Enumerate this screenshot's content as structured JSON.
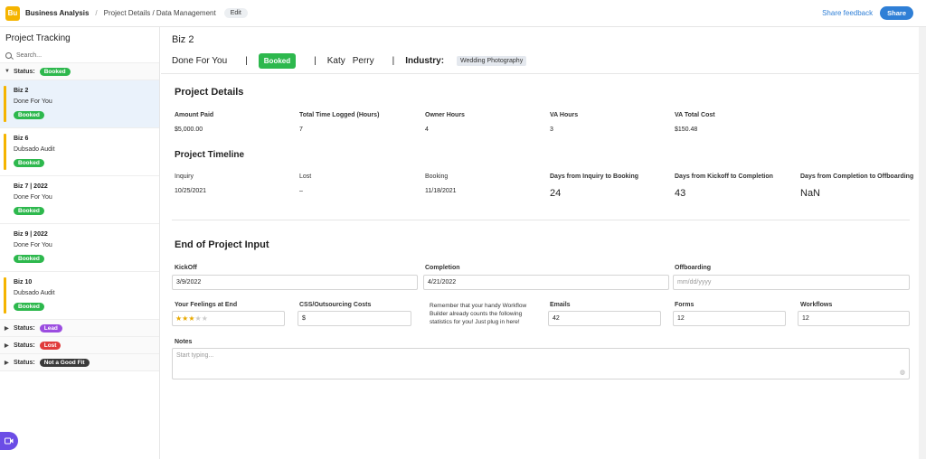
{
  "topbar": {
    "logo_text": "Bu",
    "app_title": "Business Analysis",
    "separator": "/",
    "breadcrumb": "Project Details / Data Management",
    "edit_label": "Edit",
    "share_feedback": "Share feedback",
    "share_label": "Share"
  },
  "sidebar": {
    "title": "Project Tracking",
    "search_placeholder": "Search...",
    "status_label": "Status:",
    "groups": [
      {
        "status": "Booked"
      },
      {
        "status": "Lead"
      },
      {
        "status": "Lost"
      },
      {
        "status": "Not a Good Fit"
      }
    ],
    "cards": [
      {
        "title": "Biz 2",
        "subtitle": "Done For You",
        "badge": "Booked"
      },
      {
        "title": "Biz 6",
        "subtitle": "Dubsado Audit",
        "badge": "Booked"
      },
      {
        "title": "Biz 7 | 2022",
        "subtitle": "Done For You",
        "badge": "Booked"
      },
      {
        "title": "Biz 9 | 2022",
        "subtitle": "Done For You",
        "badge": "Booked"
      },
      {
        "title": "Biz 10",
        "subtitle": "Dubsado Audit",
        "badge": "Booked"
      }
    ]
  },
  "record": {
    "title": "Biz 2",
    "service": "Done For You",
    "pipe": "|",
    "status": "Booked",
    "first_name": "Katy",
    "last_name": "Perry",
    "industry_label": "Industry:",
    "industry": "Wedding Photography"
  },
  "details": {
    "title": "Project Details",
    "fields": [
      {
        "label": "Amount Paid",
        "value": "$5,000.00"
      },
      {
        "label": "Total Time Logged (Hours)",
        "value": "7"
      },
      {
        "label": "Owner Hours",
        "value": "4"
      },
      {
        "label": "VA Hours",
        "value": "3"
      },
      {
        "label": "VA Total Cost",
        "value": "$150.48"
      }
    ]
  },
  "timeline": {
    "title": "Project Timeline",
    "fields": [
      {
        "label": "Inquiry",
        "value": "10/25/2021"
      },
      {
        "label": "Lost",
        "value": "–"
      },
      {
        "label": "Booking",
        "value": "11/18/2021"
      },
      {
        "label": "Days from Inquiry to Booking",
        "value": "24"
      },
      {
        "label": "Days from Kickoff to Completion",
        "value": "43"
      },
      {
        "label": "Days from Completion to Offboarding",
        "value": "NaN"
      }
    ]
  },
  "end_input": {
    "title": "End of Project Input",
    "kickoff_label": "KickOff",
    "kickoff_value": "3/9/2022",
    "completion_label": "Completion",
    "completion_value": "4/21/2022",
    "offboarding_label": "Offboarding",
    "offboarding_placeholder": "mm/dd/yyyy",
    "feelings_label": "Your Feelings at End",
    "feelings_rating": 3,
    "feelings_max": 5,
    "costs_label": "CSS/Outsourcing Costs",
    "costs_value": "$",
    "reminder": "Remember that your handy Workflow Builder already counts the following statistics for you! Just plug in here!",
    "emails_label": "Emails",
    "emails_value": "42",
    "forms_label": "Forms",
    "forms_value": "12",
    "workflows_label": "Workflows",
    "workflows_value": "12",
    "notes_label": "Notes",
    "notes_placeholder": "Start typing..."
  },
  "colors": {
    "accent": "#2f7fd6",
    "booked": "#2db84d",
    "lead": "#9b4de0",
    "lost": "#e03b3b",
    "not_a_good_fit": "#3a3a3a",
    "card_bar": "#f5b400",
    "selected_bg": "#eaf2fb"
  }
}
